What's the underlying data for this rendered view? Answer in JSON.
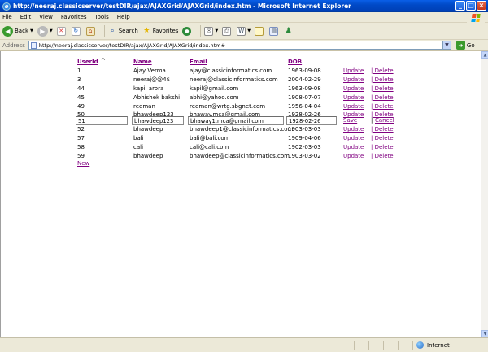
{
  "window": {
    "title": "http://neeraj.classicserver/testDIR/ajax/AJAXGrid/AJAXGrid/index.htm - Microsoft Internet Explorer",
    "min": "_",
    "max": "□",
    "close": "×"
  },
  "menu": [
    "File",
    "Edit",
    "View",
    "Favorites",
    "Tools",
    "Help"
  ],
  "toolbar": {
    "back": "Back",
    "search": "Search",
    "favorites": "Favorites"
  },
  "address": {
    "label": "Address",
    "url": "http://neeraj.classicserver/testDIR/ajax/AJAXGrid/AJAXGrid/index.htm#",
    "go": "Go"
  },
  "grid": {
    "headers": {
      "userid": "UserId",
      "sort_marker": "^",
      "name": "Name",
      "email": "Email",
      "dob": "DOB"
    },
    "rows": [
      {
        "id": "1",
        "name": "Ajay Verma",
        "email": "ajay@classicinformatics.com",
        "dob": "1963-09-08"
      },
      {
        "id": "3",
        "name": "neeraj@@4$",
        "email": "neeraj@classicinformatics.com",
        "dob": "2004-02-29"
      },
      {
        "id": "44",
        "name": "kapil arora",
        "email": "kapil@gmail.com",
        "dob": "1963-09-08"
      },
      {
        "id": "45",
        "name": "Abhishek bakshi",
        "email": "abhi@yahoo.com",
        "dob": "1908-07-07"
      },
      {
        "id": "49",
        "name": "reeman",
        "email": "reeman@wrtg.sbgnet.com",
        "dob": "1956-04-04"
      },
      {
        "id": "50",
        "name": "bhawdeep123",
        "email": "bhaway.mca@gmail.com",
        "dob": "1928-02-26"
      }
    ],
    "edit_row": {
      "id": "51",
      "name": "bhawdeep123",
      "email": "bhaway1.mca@gmail.com",
      "dob": "1928-02-26",
      "save": "Save",
      "cancel": "Cancel"
    },
    "rows_after": [
      {
        "id": "52",
        "name": "bhawdeep",
        "email": "bhawdeep1@classicinformatics.com",
        "dob": "1903-03-03"
      },
      {
        "id": "57",
        "name": "bali",
        "email": "bali@bali.com",
        "dob": "1909-04-06"
      },
      {
        "id": "58",
        "name": "cali",
        "email": "cali@cali.com",
        "dob": "1902-03-03"
      },
      {
        "id": "59",
        "name": "bhawdeep",
        "email": "bhawdeep@classicinformatics.com",
        "dob": "1903-03-02"
      }
    ],
    "update_label": "Update",
    "delete_label": "| Delete",
    "new_label": "New"
  },
  "status": {
    "zone": "Internet"
  },
  "colors": {
    "link": "#800080",
    "titlebar": "#0049c6",
    "chrome": "#ece9d8"
  }
}
